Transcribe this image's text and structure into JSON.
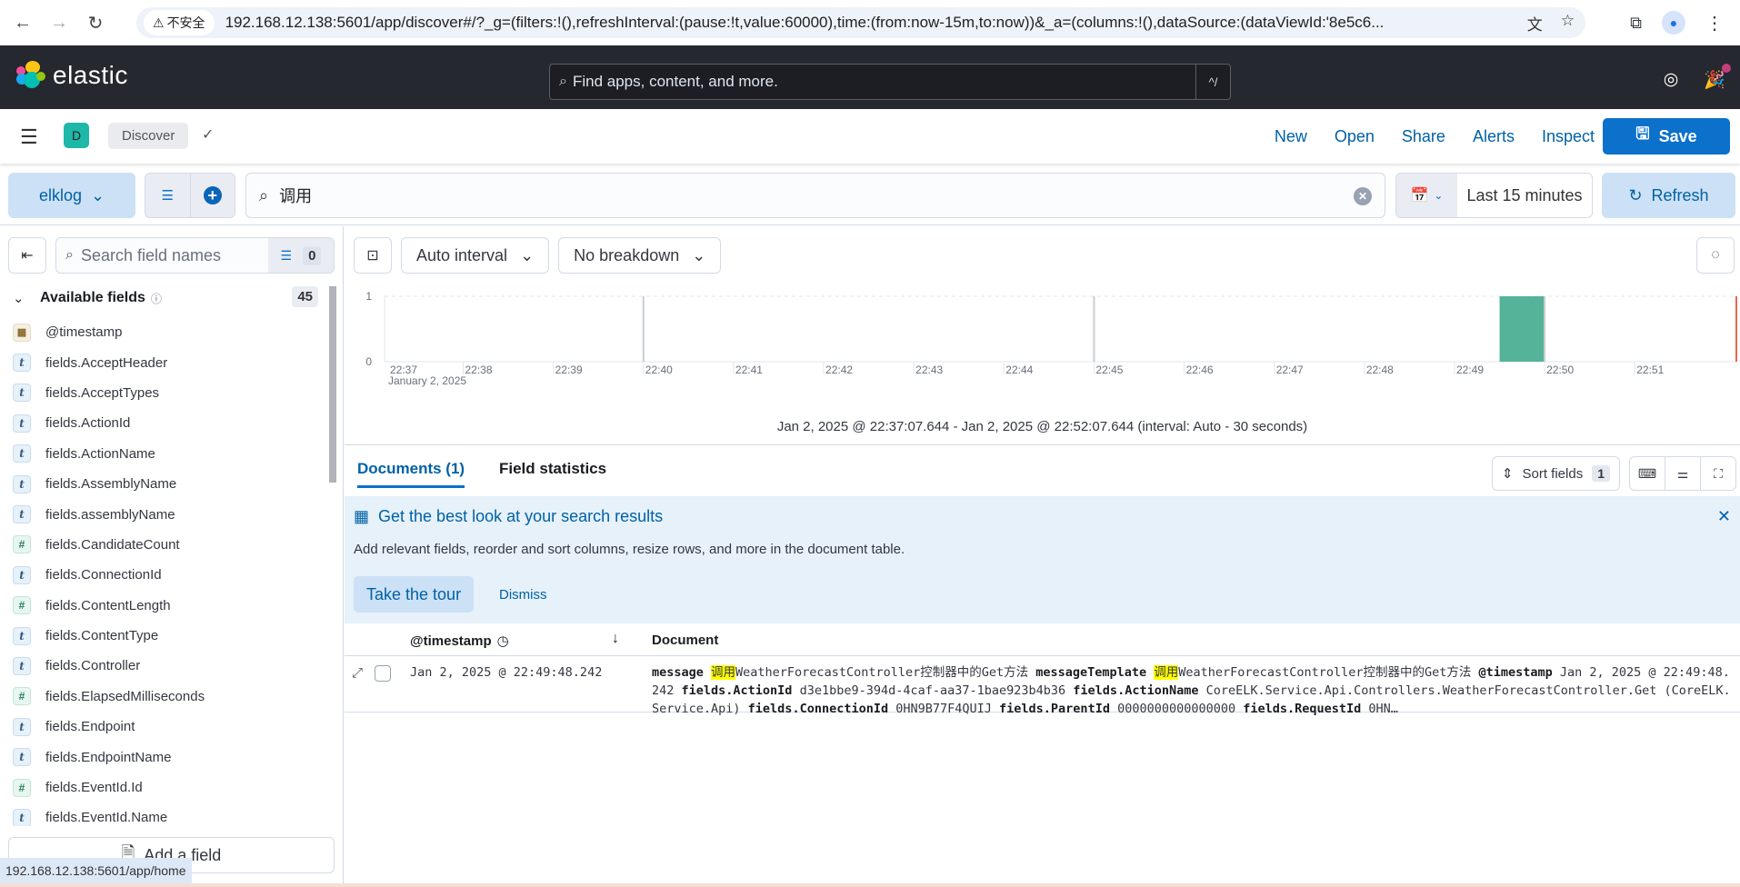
{
  "browser": {
    "security_label": "不安全",
    "url": "192.168.12.138:5601/app/discover#/?_g=(filters:!(),refreshInterval:(pause:!t,value:60000),time:(from:now-15m,to:now))&_a=(columns:!(),dataSource:(dataViewId:'8e5c6...",
    "status_url": "192.168.12.138:5601/app/home"
  },
  "header": {
    "logo_text": "elastic",
    "search_placeholder": "Find apps, content, and more.",
    "search_shortcut": "^/"
  },
  "appbar": {
    "space_initial": "D",
    "breadcrumb": "Discover",
    "links": [
      "New",
      "Open",
      "Share",
      "Alerts",
      "Inspect"
    ],
    "save_label": "Save"
  },
  "querybar": {
    "dataview": "elklog",
    "query": "调用",
    "time_range": "Last 15 minutes",
    "refresh_label": "Refresh"
  },
  "sidebar": {
    "search_placeholder": "Search field names",
    "filter_count": "0",
    "available_title": "Available fields",
    "available_count": "45",
    "fields": [
      {
        "type": "date",
        "name": "@timestamp"
      },
      {
        "type": "t",
        "name": "fields.AcceptHeader"
      },
      {
        "type": "t",
        "name": "fields.AcceptTypes"
      },
      {
        "type": "t",
        "name": "fields.ActionId"
      },
      {
        "type": "t",
        "name": "fields.ActionName"
      },
      {
        "type": "t",
        "name": "fields.AssemblyName"
      },
      {
        "type": "t",
        "name": "fields.assemblyName"
      },
      {
        "type": "#",
        "name": "fields.CandidateCount"
      },
      {
        "type": "t",
        "name": "fields.ConnectionId"
      },
      {
        "type": "#",
        "name": "fields.ContentLength"
      },
      {
        "type": "t",
        "name": "fields.ContentType"
      },
      {
        "type": "t",
        "name": "fields.Controller"
      },
      {
        "type": "#",
        "name": "fields.ElapsedMilliseconds"
      },
      {
        "type": "t",
        "name": "fields.Endpoint"
      },
      {
        "type": "t",
        "name": "fields.EndpointName"
      },
      {
        "type": "#",
        "name": "fields.EventId.Id"
      },
      {
        "type": "t",
        "name": "fields.EventId.Name"
      }
    ],
    "add_field_label": "Add a field"
  },
  "chart_toolbar": {
    "interval": "Auto interval",
    "breakdown": "No breakdown"
  },
  "chart_data": {
    "type": "bar",
    "title": "",
    "xlabel": "",
    "ylabel": "",
    "x_ticks": [
      "22:37",
      "22:38",
      "22:39",
      "22:40",
      "22:41",
      "22:42",
      "22:43",
      "22:44",
      "22:45",
      "22:46",
      "22:47",
      "22:48",
      "22:49",
      "22:50",
      "22:51"
    ],
    "x_subtitle": "January 2, 2025",
    "y_ticks": [
      "0",
      "1"
    ],
    "ylim": [
      0,
      1
    ],
    "x_range": [
      "22:37:07.644",
      "22:52:07.644"
    ],
    "interval_seconds": 30,
    "bars": [
      {
        "start": "22:49:30",
        "end": "22:50:00",
        "count": 1
      }
    ],
    "bar_color": "#54b399",
    "now_marker_color": "#e7664c",
    "caption": "Jan 2, 2025 @ 22:37:07.644 - Jan 2, 2025 @ 22:52:07.644 (interval: Auto - 30 seconds)"
  },
  "tabs": {
    "documents": "Documents (1)",
    "field_statistics": "Field statistics"
  },
  "sort": {
    "label": "Sort fields",
    "count": "1"
  },
  "callout": {
    "title": "Get the best look at your search results",
    "description": "Add relevant fields, reorder and sort columns, resize rows, and more in the document table.",
    "tour_label": "Take the tour",
    "dismiss_label": "Dismiss"
  },
  "table": {
    "col_timestamp": "@timestamp",
    "col_document": "Document",
    "rows": [
      {
        "timestamp": "Jan 2, 2025 @ 22:49:48.242",
        "doc": [
          {
            "k": "message",
            "hl": "调用",
            "v": "WeatherForecastController控制器中的Get方法"
          },
          {
            "k": "messageTemplate",
            "hl": "调用",
            "v": "WeatherForecastController控制器中的Get方法"
          },
          {
            "k": "@timestamp",
            "v": "Jan 2, 2025 @ 22:49:48.242"
          },
          {
            "k": "fields.ActionId",
            "v": "d3e1bbe9-394d-4caf-aa37-1bae923b4b36"
          },
          {
            "k": "fields.ActionName",
            "v": "CoreELK.Service.Api.Controllers.WeatherForecastController.Get (CoreELK.Service.Api)"
          },
          {
            "k": "fields.ConnectionId",
            "v": "0HN9B77F4QUIJ"
          },
          {
            "k": "fields.ParentId",
            "v": "0000000000000000"
          },
          {
            "k": "fields.RequestId",
            "v": "0HN…"
          }
        ]
      }
    ]
  }
}
